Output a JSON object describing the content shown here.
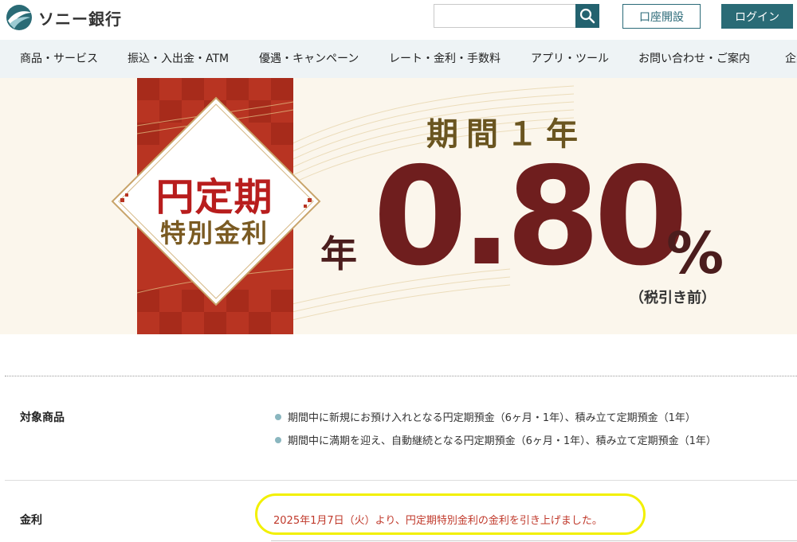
{
  "header": {
    "brand": "ソニー銀行",
    "search_placeholder": "",
    "account_open_label": "口座開設",
    "login_label": "ログイン"
  },
  "nav": {
    "items": [
      "商品・サービス",
      "振込・入出金・ATM",
      "優遇・キャンペーン",
      "レート・金利・手数料",
      "アプリ・ツール",
      "お問い合わせ・ご案内",
      "企業"
    ]
  },
  "banner": {
    "title": "円定期",
    "subtitle": "特別金利",
    "period": "期間１年",
    "prefix": "年",
    "rate": "0.80",
    "percent": "%",
    "tax_note": "（税引き前）"
  },
  "details": {
    "target_label": "対象商品",
    "target_items": [
      "期間中に新規にお預け入れとなる円定期預金（6ヶ月・1年）、積み立て定期預金（1年）",
      "期間中に満期を迎え、自動継続となる円定期預金（6ヶ月・1年）、積み立て定期預金（1年）"
    ],
    "rate_label": "金利",
    "rate_notice": "2025年1月7日（火）より、円定期特別金利の金利を引き上げました。"
  },
  "colors": {
    "primary": "#2a6b76",
    "badge_red": "#b83422",
    "rate_color": "#6f1e1e",
    "notice_red": "#c0392b",
    "highlight": "#f2f000"
  }
}
